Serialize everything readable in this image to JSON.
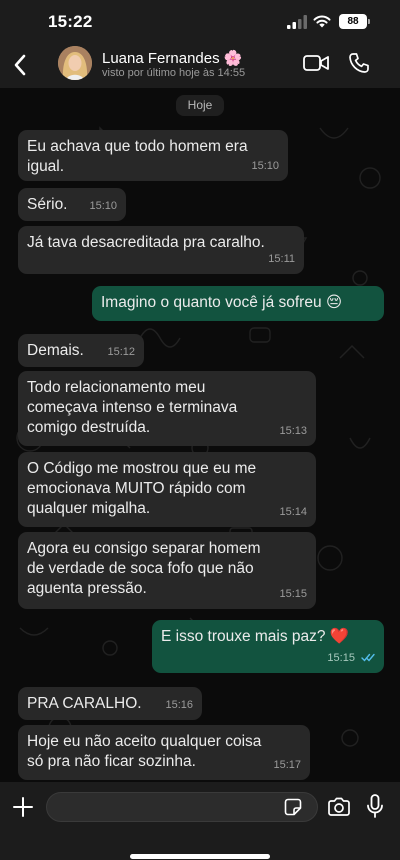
{
  "status_bar": {
    "time": "15:22",
    "battery": "88"
  },
  "header": {
    "contact_name": "Luana Fernandes 🌸",
    "contact_status": "visto por último hoje às 14:55"
  },
  "chat": {
    "date_label": "Hoje",
    "messages": [
      {
        "direction": "in",
        "text": "Eu achava que todo homem era\nigual.",
        "time": "15:10"
      },
      {
        "direction": "in",
        "text": "Sério.",
        "time": "15:10"
      },
      {
        "direction": "in",
        "text": "Já tava desacreditada pra caralho.",
        "time": "15:11"
      },
      {
        "direction": "out",
        "text": "Imagino o quanto você já sofreu 😔",
        "time": ""
      },
      {
        "direction": "in",
        "text": "Demais.",
        "time": "15:12"
      },
      {
        "direction": "in",
        "text": "Todo relacionamento meu\ncomeçava intenso e terminava\ncomigo destruída.",
        "time": "15:13"
      },
      {
        "direction": "in",
        "text": "O Código me mostrou que eu me\nemocionava MUITO rápido com\nqualquer migalha.",
        "time": "15:14"
      },
      {
        "direction": "in",
        "text": "Agora eu consigo separar homem\nde verdade de soca fofo que não\naguenta pressão.",
        "time": "15:15"
      },
      {
        "direction": "out",
        "text": "E isso trouxe mais paz? ❤️",
        "time": "15:15",
        "read": true
      },
      {
        "direction": "in",
        "text": "PRA CARALHO.",
        "time": "15:16"
      },
      {
        "direction": "in",
        "text": "Hoje eu não aceito qualquer coisa\nsó pra não ficar sozinha.",
        "time": "15:17"
      }
    ]
  },
  "input": {
    "placeholder": ""
  },
  "colors": {
    "bubble_in": "#282828",
    "bubble_out": "#12533f",
    "read_ticks": "#53bdeb",
    "background": "#0b0b0b"
  },
  "icons": [
    "back-icon",
    "video-call-icon",
    "phone-icon",
    "plus-icon",
    "sticker-icon",
    "camera-icon",
    "mic-icon"
  ]
}
